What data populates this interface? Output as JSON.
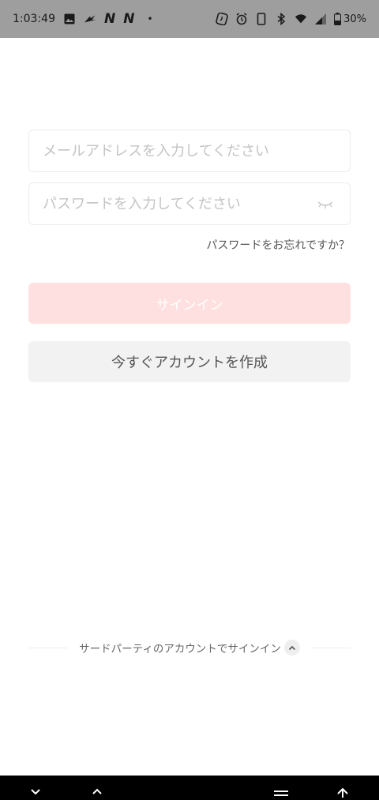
{
  "status_bar": {
    "time": "1:03:49",
    "notification_letters": [
      "N",
      "N"
    ],
    "dot": "•",
    "battery_percent": "30%",
    "icons": [
      "image-icon",
      "sketch-icon",
      "nfc-icon",
      "alarm-icon",
      "phone-icon",
      "bluetooth-icon",
      "wifi-icon",
      "signal-icon",
      "battery-icon"
    ]
  },
  "login_form": {
    "email_placeholder": "メールアドレスを入力してください",
    "email_value": "",
    "password_placeholder": "パスワードを入力してください",
    "password_value": "",
    "forgot_password": "パスワードをお忘れですか？",
    "signin_label": "サインイン",
    "create_account_label": "今すぐアカウントを作成"
  },
  "third_party": {
    "label": "サードパーティのアカウントでサインイン"
  },
  "colors": {
    "status_bar_bg": "#9e9e9e",
    "signin_bg": "#ffe0e0",
    "create_bg": "#f2f2f2",
    "nav_bg": "#000000"
  },
  "nav_bar": {
    "icons": [
      "chevron-down-icon",
      "chevron-up-icon",
      "menu-icon",
      "arrow-up-icon"
    ]
  }
}
